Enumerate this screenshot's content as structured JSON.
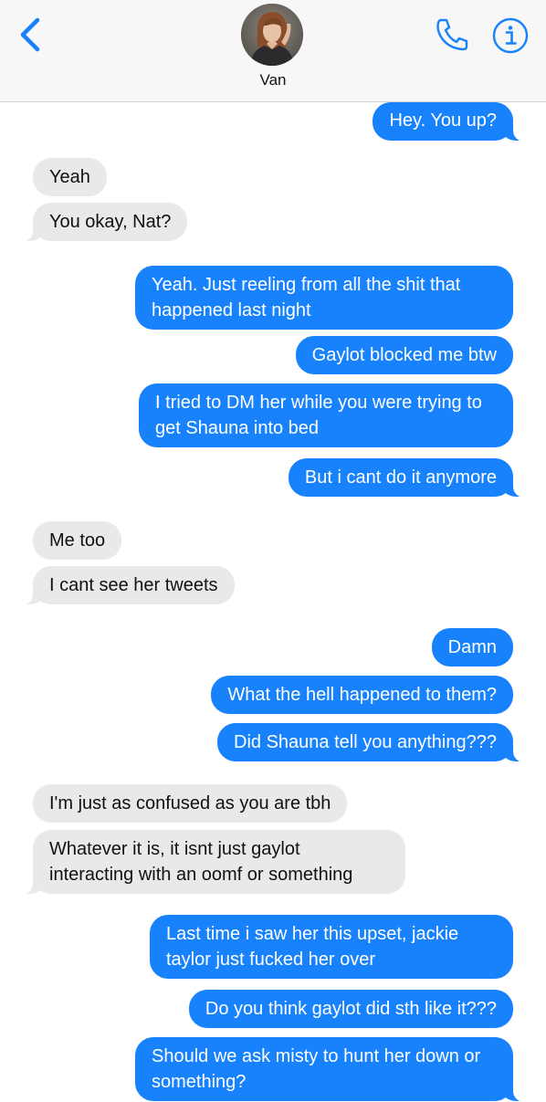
{
  "header": {
    "contact_name": "Van",
    "back_icon": "chevron-left-icon",
    "phone_icon": "phone-icon",
    "info_icon": "info-icon",
    "accent_color": "#1782fb"
  },
  "messages": [
    {
      "side": "sent",
      "text": "Hey. You up?"
    },
    {
      "side": "received",
      "text": "Yeah"
    },
    {
      "side": "received",
      "text": "You okay, Nat?"
    },
    {
      "side": "sent",
      "text": "Yeah. Just reeling from all the shit that happened last night"
    },
    {
      "side": "sent",
      "text": "Gaylot blocked me btw"
    },
    {
      "side": "sent",
      "text": "I tried to DM her while you were trying to get Shauna into bed"
    },
    {
      "side": "sent",
      "text": "But i cant do it anymore"
    },
    {
      "side": "received",
      "text": "Me too"
    },
    {
      "side": "received",
      "text": "I cant see her tweets"
    },
    {
      "side": "sent",
      "text": "Damn"
    },
    {
      "side": "sent",
      "text": "What the hell happened to them?"
    },
    {
      "side": "sent",
      "text": "Did Shauna tell you anything???"
    },
    {
      "side": "received",
      "text": "I'm just as confused as you are tbh"
    },
    {
      "side": "received",
      "text": "Whatever it is, it isnt just gaylot interacting with an oomf or something"
    },
    {
      "side": "sent",
      "text": "Last time i saw her this upset, jackie taylor just fucked her over"
    },
    {
      "side": "sent",
      "text": "Do you think gaylot did sth like it???"
    },
    {
      "side": "sent",
      "text": "Should we ask misty to hunt her down or something?"
    }
  ]
}
